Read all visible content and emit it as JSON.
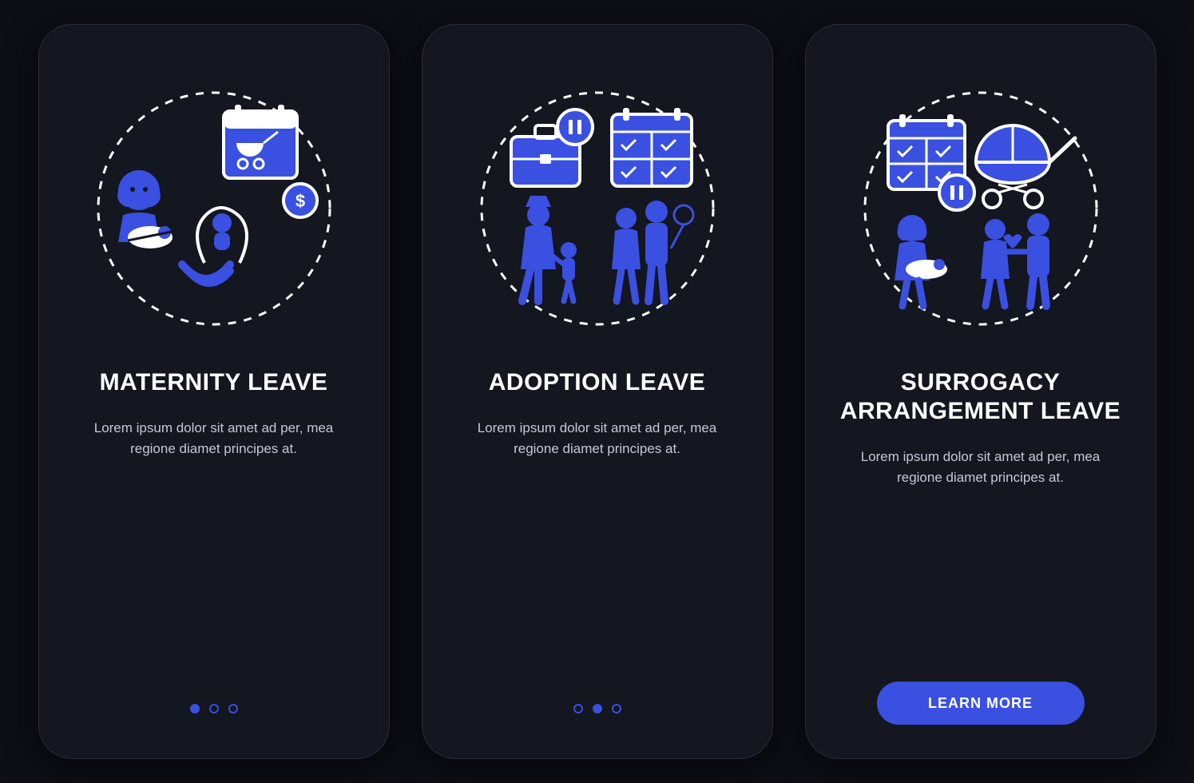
{
  "colors": {
    "accent": "#3a50e0",
    "bg": "#0e0f16",
    "card": "#141620"
  },
  "screens": [
    {
      "title": "Maternity Leave",
      "description": "Lorem ipsum dolor sit amet ad per, mea regione diamet principes at.",
      "dots": {
        "count": 3,
        "active": 0
      },
      "icons": [
        "woman-with-baby-icon",
        "calendar-stroller-icon",
        "money-icon",
        "child-in-hands-icon"
      ]
    },
    {
      "title": "Adoption Leave",
      "description": "Lorem ipsum dolor sit amet ad per, mea regione diamet principes at.",
      "dots": {
        "count": 3,
        "active": 1
      },
      "icons": [
        "briefcase-pause-icon",
        "calendar-checks-icon",
        "official-with-child-icon",
        "family-balloon-icon"
      ]
    },
    {
      "title": "Surrogacy\nArrangement Leave",
      "description": "Lorem ipsum dolor sit amet ad per, mea regione diamet principes at.",
      "cta_label": "LEARN MORE",
      "icons": [
        "calendar-checks-pause-icon",
        "stroller-icon",
        "woman-with-baby-icon",
        "couple-heart-icon"
      ]
    }
  ]
}
